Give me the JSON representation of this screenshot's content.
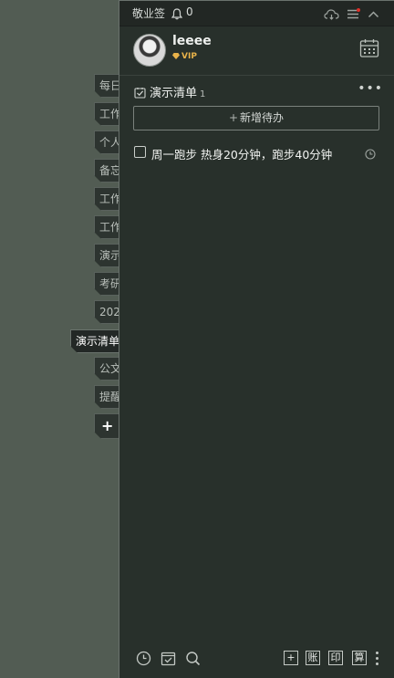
{
  "tabs": [
    {
      "label": "每日"
    },
    {
      "label": "工作"
    },
    {
      "label": "个人"
    },
    {
      "label": "备忘"
    },
    {
      "label": "工作"
    },
    {
      "label": "工作"
    },
    {
      "label": "演示"
    },
    {
      "label": "考研"
    },
    {
      "label": "202"
    },
    {
      "label": "演示清单"
    },
    {
      "label": "公文"
    },
    {
      "label": "提醒"
    },
    {
      "label": "+"
    }
  ],
  "titlebar": {
    "app_name": "敬业签",
    "notification_count": "0"
  },
  "profile": {
    "username": "leeee",
    "badge": "VIP"
  },
  "list": {
    "title": "演示清单",
    "count": "1"
  },
  "add_todo": {
    "plus": "+",
    "label": "新增待办"
  },
  "todos": [
    {
      "text": "周一跑步 热身20分钟，跑步40分钟",
      "checked": false
    }
  ],
  "bottom": {
    "add": "+",
    "account": "账",
    "print": "印",
    "calc": "算"
  },
  "colors": {
    "accent_badge": "#e8b24a",
    "panel_bg": "#28302b",
    "desktop_bg": "#525c53",
    "notify_dot": "#e0302a"
  }
}
